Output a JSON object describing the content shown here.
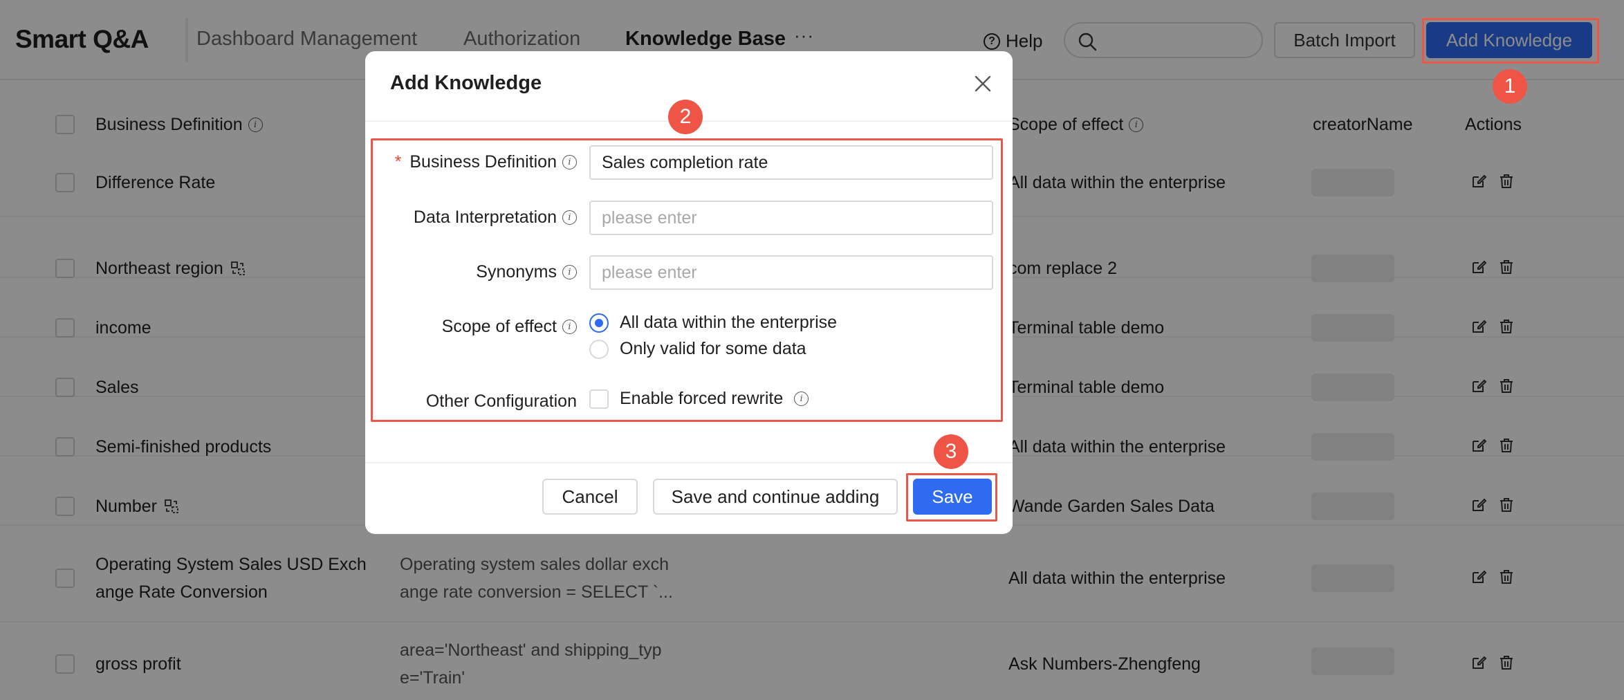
{
  "app": {
    "title": "Smart Q&A"
  },
  "nav": {
    "tabs": [
      {
        "label": "Dashboard Management"
      },
      {
        "label": "Authorization"
      },
      {
        "label": "Knowledge Base"
      }
    ],
    "more": "···"
  },
  "header": {
    "help_label": "Help",
    "search_placeholder": "",
    "batch_import_label": "Batch Import",
    "add_knowledge_label": "Add Knowledge"
  },
  "table": {
    "columns": {
      "business_definition": "Business Definition",
      "scope_of_effect": "Scope of effect",
      "creator_name": "creatorName",
      "actions": "Actions"
    },
    "rows": [
      {
        "name": "Difference Rate",
        "interp1": "",
        "interp2": "",
        "scope": "All data within the enterprise"
      },
      {
        "name": "Northeast region",
        "interp1": "",
        "interp2": "",
        "scope": "com replace 2"
      },
      {
        "name": "income",
        "interp1": "",
        "interp2": "",
        "scope": "Terminal table demo"
      },
      {
        "name": "Sales",
        "interp1": "",
        "interp2": "",
        "scope": "Terminal table demo"
      },
      {
        "name": "Semi-finished products",
        "interp1": "",
        "interp2": "",
        "scope": "All data within the enterprise"
      },
      {
        "name": "Number",
        "interp1": "",
        "interp2": "",
        "scope": "Wande Garden Sales Data"
      },
      {
        "name": "Operating System Sales USD Exch",
        "name2": "ange Rate Conversion",
        "interp1": "Operating system sales dollar exch",
        "interp2": "ange rate conversion = SELECT `...",
        "scope": "All data within the enterprise"
      },
      {
        "name": "gross profit",
        "interp1": "area='Northeast' and shipping_typ",
        "interp2": "e='Train'",
        "scope": "Ask Numbers-Zhengfeng"
      }
    ]
  },
  "dialog": {
    "title": "Add Knowledge",
    "required_mark": "*",
    "fields": {
      "business_definition": {
        "label": "Business Definition",
        "value": "Sales completion rate"
      },
      "data_interpretation": {
        "label": "Data Interpretation",
        "placeholder": "please enter"
      },
      "synonyms": {
        "label": "Synonyms",
        "placeholder": "please enter"
      },
      "scope_of_effect": {
        "label": "Scope of effect",
        "options": [
          "All data within the enterprise",
          "Only valid for some data"
        ],
        "selected": "All data within the enterprise"
      },
      "other_configuration": {
        "label": "Other Configuration",
        "checkbox_label": "Enable forced rewrite"
      }
    },
    "buttons": {
      "cancel": "Cancel",
      "save_continue": "Save and continue adding",
      "save": "Save"
    }
  },
  "callouts": [
    "1",
    "2",
    "3"
  ],
  "colors": {
    "primary": "#2f6bf0",
    "callout": "#ee5546",
    "required": "#e84a3a"
  },
  "icons": [
    "help-icon",
    "search-icon",
    "info-icon",
    "mapping-icon",
    "edit-icon",
    "delete-icon",
    "close-icon"
  ]
}
